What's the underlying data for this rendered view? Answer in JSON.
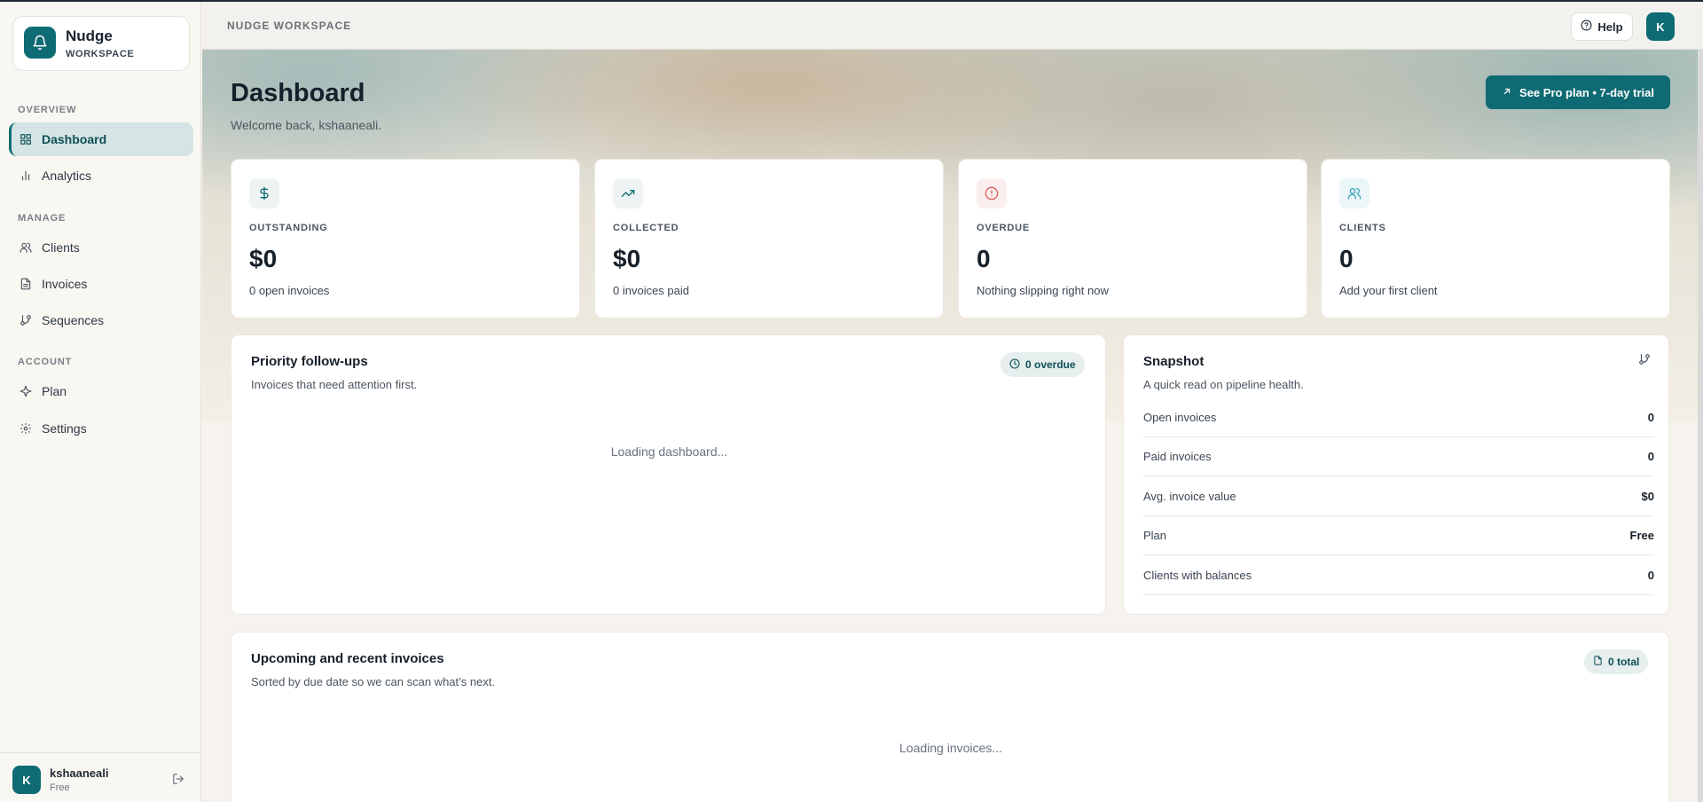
{
  "brand": {
    "name": "Nudge",
    "sub": "WORKSPACE"
  },
  "nav": {
    "sections": {
      "overview": "OVERVIEW",
      "manage": "MANAGE",
      "account": "ACCOUNT"
    },
    "items": [
      {
        "label": "Dashboard",
        "icon": "grid-icon"
      },
      {
        "label": "Analytics",
        "icon": "bar-chart-icon"
      },
      {
        "label": "Clients",
        "icon": "users-icon"
      },
      {
        "label": "Invoices",
        "icon": "document-icon"
      },
      {
        "label": "Sequences",
        "icon": "git-branch-icon"
      },
      {
        "label": "Plan",
        "icon": "sparkle-icon"
      },
      {
        "label": "Settings",
        "icon": "gear-icon"
      }
    ]
  },
  "user": {
    "initial": "K",
    "name": "kshaaneali",
    "plan": "Free"
  },
  "topbar": {
    "workspace": "NUDGE WORKSPACE",
    "help": "Help",
    "avatar": "K"
  },
  "header": {
    "title": "Dashboard",
    "subtitle": "Welcome back, kshaaneali.",
    "pro_button": "See Pro plan • 7-day trial"
  },
  "stats": [
    {
      "label": "OUTSTANDING",
      "value": "$0",
      "sub": "0 open invoices",
      "icon": "dollar-icon"
    },
    {
      "label": "COLLECTED",
      "value": "$0",
      "sub": "0 invoices paid",
      "icon": "trending-up-icon"
    },
    {
      "label": "OVERDUE",
      "value": "0",
      "sub": "Nothing slipping right now",
      "icon": "alert-circle-icon"
    },
    {
      "label": "CLIENTS",
      "value": "0",
      "sub": "Add your first client",
      "icon": "users-icon"
    }
  ],
  "priority": {
    "title": "Priority follow-ups",
    "subtitle": "Invoices that need attention first.",
    "badge": "0 overdue",
    "loading": "Loading dashboard..."
  },
  "snapshot": {
    "title": "Snapshot",
    "subtitle": "A quick read on pipeline health.",
    "rows": [
      {
        "label": "Open invoices",
        "value": "0"
      },
      {
        "label": "Paid invoices",
        "value": "0"
      },
      {
        "label": "Avg. invoice value",
        "value": "$0"
      },
      {
        "label": "Plan",
        "value": "Free"
      },
      {
        "label": "Clients with balances",
        "value": "0"
      }
    ]
  },
  "invoices": {
    "title": "Upcoming and recent invoices",
    "subtitle": "Sorted by due date so we can scan what’s next.",
    "badge": "0 total",
    "loading": "Loading invoices..."
  },
  "colors": {
    "accent": "#0f6b73",
    "danger": "#e05a5a",
    "info": "#3aa6b9"
  }
}
